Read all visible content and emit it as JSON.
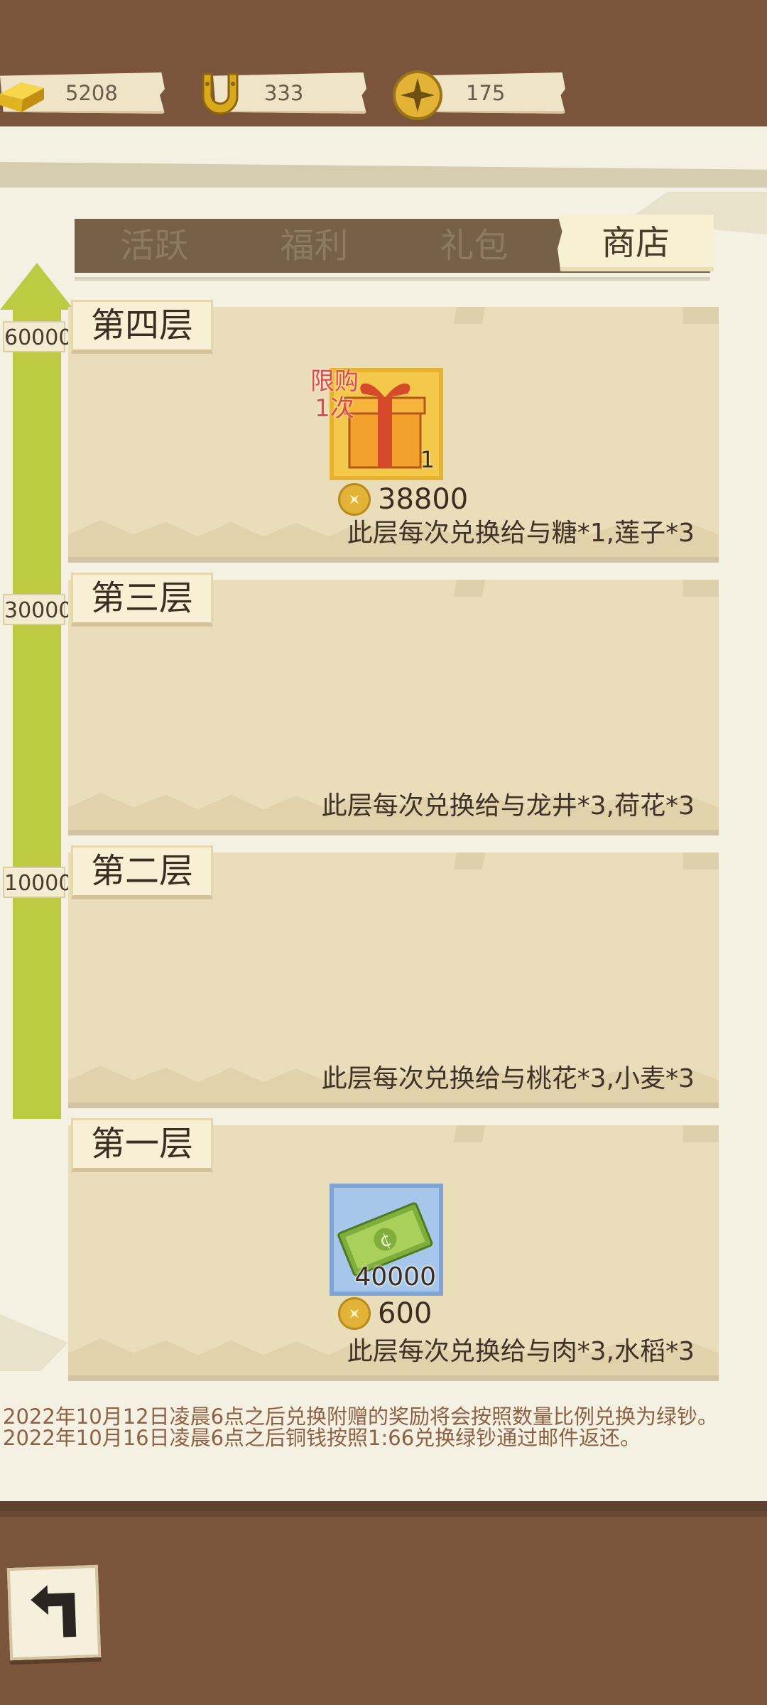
{
  "currencies": [
    {
      "name": "gold-bar",
      "icon": "gold-bar-icon",
      "value": "5208"
    },
    {
      "name": "horseshoe",
      "icon": "horseshoe-icon",
      "value": "333"
    },
    {
      "name": "copper-coin",
      "icon": "copper-coin-icon",
      "value": "175"
    }
  ],
  "tabs": [
    {
      "label": "活跃",
      "active": false
    },
    {
      "label": "福利",
      "active": false
    },
    {
      "label": "礼包",
      "active": false
    },
    {
      "label": "商店",
      "active": true
    }
  ],
  "progress": {
    "thresholds": [
      "60000",
      "30000",
      "10000"
    ],
    "color": "#bccb42"
  },
  "floors": [
    {
      "title": "第四层",
      "description": "此层每次兑换给与糖*1,莲子*3",
      "item": {
        "icon": "gift-box-icon",
        "count": "1",
        "limit_line1": "限购",
        "limit_line2": "1次",
        "price": "38800"
      }
    },
    {
      "title": "第三层",
      "description": "此层每次兑换给与龙井*3,荷花*3"
    },
    {
      "title": "第二层",
      "description": "此层每次兑换给与桃花*3,小麦*3"
    },
    {
      "title": "第一层",
      "description": "此层每次兑换给与肉*3,水稻*3",
      "item": {
        "icon": "green-cash-icon",
        "count": "40000",
        "price": "600"
      }
    }
  ],
  "notices": [
    "2022年10月12日凌晨6点之后兑换附赠的奖励将会按照数量比例兑换为绿钞。",
    "2022年10月16日凌晨6点之后铜钱按照1:66兑换绿钞通过邮件返还。"
  ],
  "colors": {
    "background": "#7a553b",
    "panel": "#f4f1e3",
    "floor": "#eaddba",
    "tab_bar": "#766046",
    "limit_text": "#e04a4a"
  }
}
